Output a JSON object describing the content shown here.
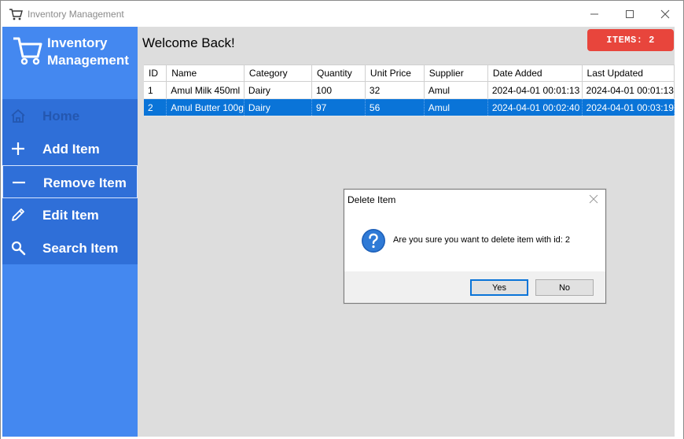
{
  "window": {
    "title": "Inventory Management",
    "icon": "cart-icon"
  },
  "sidebar": {
    "brand_line1": "Inventory",
    "brand_line2": "Management",
    "items": [
      {
        "label": "Home",
        "icon": "home-icon",
        "state": "disabled"
      },
      {
        "label": "Add Item",
        "icon": "plus-icon",
        "state": "normal"
      },
      {
        "label": "Remove Item",
        "icon": "minus-icon",
        "state": "selected"
      },
      {
        "label": "Edit Item",
        "icon": "pencil-icon",
        "state": "normal"
      },
      {
        "label": "Search Item",
        "icon": "search-icon",
        "state": "normal"
      }
    ]
  },
  "main": {
    "welcome": "Welcome Back!",
    "items_badge": "ITEMS: 2",
    "table": {
      "columns": [
        "ID",
        "Name",
        "Category",
        "Quantity",
        "Unit Price",
        "Supplier",
        "Date Added",
        "Last Updated"
      ],
      "rows": [
        [
          "1",
          "Amul Milk 450ml",
          "Dairy",
          "100",
          "32",
          "Amul",
          "2024-04-01 00:01:13",
          "2024-04-01 00:01:13"
        ],
        [
          "2",
          "Amul Butter 100g",
          "Dairy",
          "97",
          "56",
          "Amul",
          "2024-04-01 00:02:40",
          "2024-04-01 00:03:19"
        ]
      ],
      "selected_row": 2
    }
  },
  "dialog": {
    "title": "Delete Item",
    "message": "Are you sure you want to delete item with id: 2",
    "yes_label": "Yes",
    "no_label": "No",
    "icon": "question-icon"
  },
  "colors": {
    "sidebar": "#4488f0",
    "nav_item": "#2f6fd8",
    "badge": "#e8453c",
    "selection": "#0a74d8"
  }
}
